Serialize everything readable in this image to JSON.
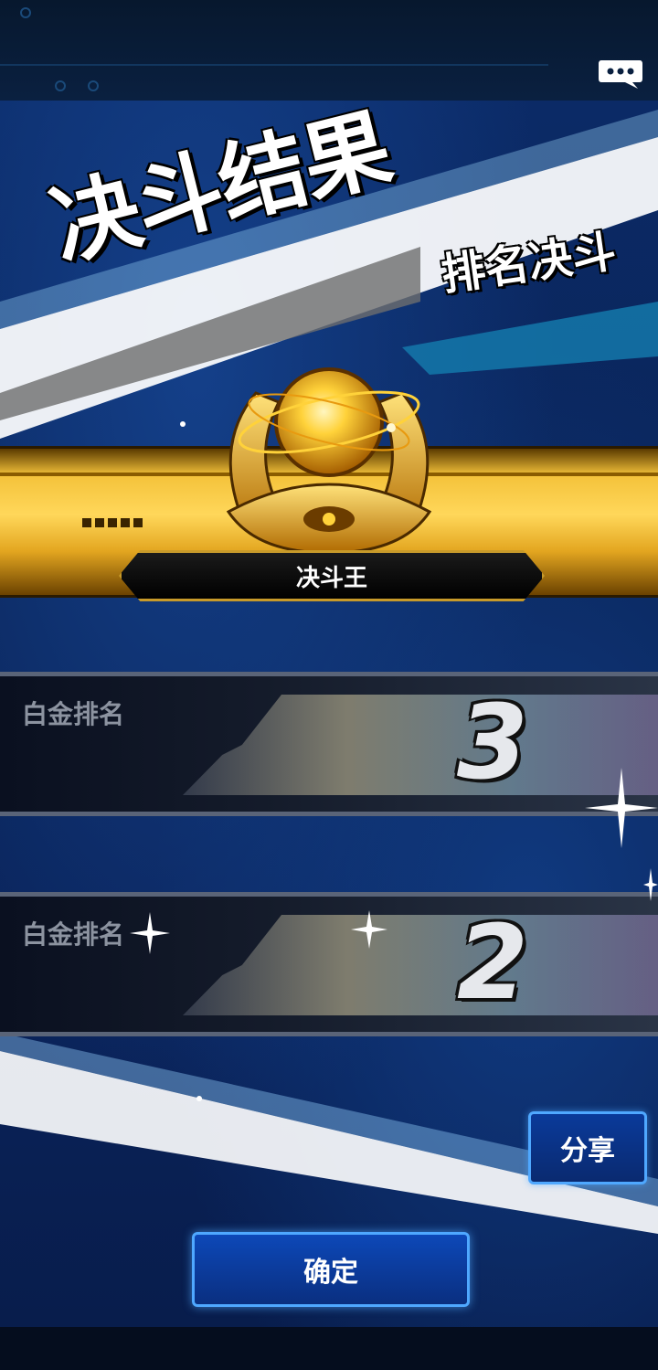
{
  "header": {
    "chat_icon": "chat-bubble-icon"
  },
  "result": {
    "title": "决斗结果",
    "mode": "排名决斗",
    "rank_title": "决斗王",
    "emblem_icon": "duel-king-gold-emblem"
  },
  "ranks": [
    {
      "label": "白金排名",
      "value": "3"
    },
    {
      "label": "白金排名",
      "value": "2"
    }
  ],
  "buttons": {
    "share": "分享",
    "confirm": "确定"
  },
  "colors": {
    "accent_blue": "#4fa8ff",
    "gold": "#f4c23a",
    "background": "#0a2458"
  }
}
